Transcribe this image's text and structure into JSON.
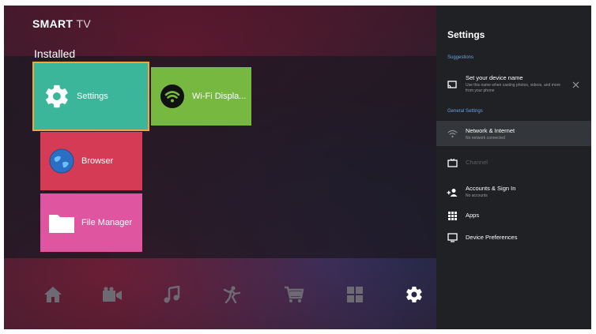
{
  "home": {
    "brand_bold": "SMART",
    "brand_light": "TV",
    "section_label": "Installed",
    "tiles": [
      {
        "label": "Settings",
        "icon": "gear-icon",
        "color": "#3bb69a",
        "focused": true
      },
      {
        "label": "Wi-Fi Displa...",
        "icon": "wifi-icon",
        "color": "#76b840"
      },
      {
        "label": "Browser",
        "icon": "globe-icon",
        "color": "#d63b55"
      },
      {
        "label": "File Manager",
        "icon": "folder-icon",
        "color": "#e0559f"
      }
    ],
    "dock": [
      "home-icon",
      "video-icon",
      "music-icon",
      "sports-icon",
      "shopping-cart-icon",
      "apps-grid-icon",
      "settings-gear-icon"
    ]
  },
  "settings_panel": {
    "title": "Settings",
    "suggestions_heading": "Suggestions",
    "suggestion": {
      "title": "Set your device name",
      "subtitle": "Use this name when casting photos, videos, and more from your phone"
    },
    "general_heading": "General Settings",
    "items": [
      {
        "title": "Network & Internet",
        "subtitle": "No network connected",
        "icon": "wifi-icon"
      },
      {
        "title": "Channel",
        "subtitle": "",
        "icon": "tv-icon",
        "disabled": true
      },
      {
        "title": "Accounts & Sign In",
        "subtitle": "No accounts",
        "icon": "add-account-icon"
      },
      {
        "title": "Apps",
        "subtitle": "",
        "icon": "apps-grid-icon"
      },
      {
        "title": "Device Preferences",
        "subtitle": "",
        "icon": "monitor-icon"
      }
    ]
  }
}
